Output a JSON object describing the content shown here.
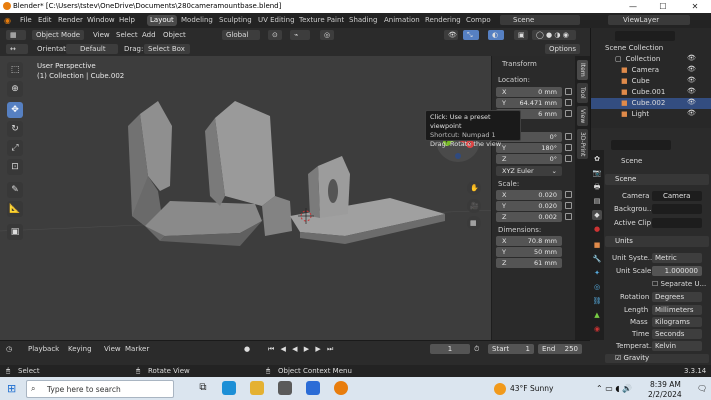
{
  "window": {
    "title": "Blender* [C:\\Users\\tstev\\OneDrive\\Documents\\280cameramountbase.blend]",
    "minimize": "—",
    "maximize": "☐",
    "close": "✕"
  },
  "menu": {
    "items": [
      "File",
      "Edit",
      "Render",
      "Window",
      "Help"
    ],
    "workspaces": [
      "Layout",
      "Modeling",
      "Sculpting",
      "UV Editing",
      "Texture Paint",
      "Shading",
      "Animation",
      "Rendering",
      "Compo"
    ],
    "scene": "Scene",
    "view_layer": "ViewLayer"
  },
  "header3d": {
    "mode": "Object Mode",
    "view": "View",
    "select": "Select",
    "add": "Add",
    "object": "Object",
    "transform": "Global",
    "options": "Options"
  },
  "options_bar": {
    "orientation_label": "Orientation:",
    "orientation": "Default",
    "drag_label": "Drag:",
    "drag": "Select Box"
  },
  "viewport": {
    "perspective": "User Perspective",
    "collection": "(1) Collection | Cube.002",
    "gizmo_x": "X",
    "gizmo_y": "Y",
    "gizmo_z": "Z"
  },
  "tooltip": {
    "line1": "Click: Use a preset viewpoint",
    "line2": "Shortcut: Numpad 1",
    "line3": "Drag: Rotate the view"
  },
  "npanel": {
    "title": "Transform",
    "location_label": "Location:",
    "location": [
      {
        "axis": "X",
        "value": "0 mm"
      },
      {
        "axis": "Y",
        "value": "64.471 mm"
      },
      {
        "axis": "Z",
        "value": "6 mm"
      }
    ],
    "rotation": [
      {
        "axis": "X",
        "value": "0°"
      },
      {
        "axis": "Y",
        "value": "180°"
      },
      {
        "axis": "Z",
        "value": "0°"
      }
    ],
    "rotation_mode": "XYZ Euler",
    "scale_label": "Scale:",
    "scale": [
      {
        "axis": "X",
        "value": "0.020"
      },
      {
        "axis": "Y",
        "value": "0.020"
      },
      {
        "axis": "Z",
        "value": "0.002"
      }
    ],
    "dimensions_label": "Dimensions:",
    "dimensions": [
      {
        "axis": "X",
        "value": "70.8 mm"
      },
      {
        "axis": "Y",
        "value": "50 mm"
      },
      {
        "axis": "Z",
        "value": "61 mm"
      }
    ],
    "tabs": [
      "Item",
      "Tool",
      "View",
      "3D-Print"
    ]
  },
  "outliner": {
    "root": "Scene Collection",
    "collection": "Collection",
    "items": [
      "Camera",
      "Cube",
      "Cube.001",
      "Cube.002",
      "Light"
    ]
  },
  "properties": {
    "scene_name": "Scene",
    "scene_section": "Scene",
    "camera_label": "Camera",
    "camera_value": "Camera",
    "background_label": "Backgrou...",
    "active_clip_label": "Active Clip",
    "units_section": "Units",
    "unit_system_label": "Unit Syste...",
    "unit_system": "Metric",
    "unit_scale_label": "Unit Scale",
    "unit_scale": "1.000000",
    "separate_units": "Separate U...",
    "rotation_label": "Rotation",
    "rotation": "Degrees",
    "length_label": "Length",
    "length": "Millimeters",
    "mass_label": "Mass",
    "mass": "Kilograms",
    "time_label": "Time",
    "time": "Seconds",
    "temperature_label": "Temperat...",
    "temperature": "Kelvin",
    "gravity": "Gravity"
  },
  "timeline": {
    "playback": "Playback",
    "keying": "Keying",
    "view": "View",
    "marker": "Marker",
    "current_frame": "1",
    "start_label": "Start",
    "start": "1",
    "end_label": "End",
    "end": "250"
  },
  "status": {
    "select": "Select",
    "rotate_view": "Rotate View",
    "context_menu": "Object Context Menu",
    "version": "3.3.14"
  },
  "taskbar": {
    "search_placeholder": "Type here to search",
    "weather": "43°F  Sunny",
    "time": "8:39 AM",
    "date": "2/2/2024"
  }
}
